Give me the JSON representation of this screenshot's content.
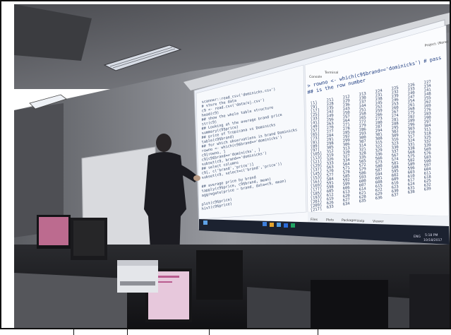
{
  "photo": {
    "description_free": true,
    "console": {
      "command": "> rowno <- which(c9$brand=='dominicks') # pass",
      "subtitle": "## is the row number",
      "tabs": [
        "Console",
        "Terminal"
      ],
      "rows": [
        [
          "[1]",
          "211",
          "212",
          "213",
          "224",
          "225",
          "226",
          "227"
        ],
        [
          "[9]",
          "228",
          "229",
          "230",
          "231",
          "232",
          "233",
          "234"
        ],
        [
          "[17]",
          "235",
          "236",
          "237",
          "238",
          "239",
          "240",
          "241"
        ],
        [
          "[25]",
          "242",
          "243",
          "244",
          "245",
          "246",
          "247",
          "248"
        ],
        [
          "[33]",
          "249",
          "250",
          "251",
          "252",
          "253",
          "254",
          "255"
        ],
        [
          "[41]",
          "256",
          "257",
          "258",
          "259",
          "260",
          "261",
          "262"
        ],
        [
          "[49]",
          "263",
          "264",
          "265",
          "266",
          "267",
          "268",
          "269"
        ],
        [
          "[57]",
          "270",
          "271",
          "272",
          "273",
          "274",
          "275",
          "276"
        ],
        [
          "[65]",
          "277",
          "278",
          "279",
          "280",
          "281",
          "282",
          "283"
        ],
        [
          "[73]",
          "284",
          "285",
          "286",
          "287",
          "288",
          "289",
          "290"
        ],
        [
          "[81]",
          "291",
          "292",
          "293",
          "294",
          "295",
          "296",
          "297"
        ],
        [
          "[89]",
          "298",
          "299",
          "300",
          "301",
          "302",
          "303",
          "304"
        ],
        [
          "[97]",
          "305",
          "306",
          "307",
          "308",
          "309",
          "310",
          "311"
        ],
        [
          "[105]",
          "312",
          "313",
          "314",
          "315",
          "316",
          "317",
          "318"
        ],
        [
          "[113]",
          "319",
          "320",
          "321",
          "322",
          "323",
          "324",
          "325"
        ],
        [
          "[121]",
          "326",
          "327",
          "328",
          "329",
          "330",
          "331",
          "332"
        ],
        [
          "[129]",
          "333",
          "334",
          "335",
          "336",
          "337",
          "338",
          "339"
        ],
        [
          "[137]",
          "563",
          "564",
          "565",
          "566",
          "567",
          "568",
          "569"
        ],
        [
          "[145]",
          "570",
          "571",
          "572",
          "573",
          "574",
          "575",
          "576"
        ],
        [
          "[153]",
          "577",
          "578",
          "579",
          "580",
          "581",
          "582",
          "583"
        ],
        [
          "[161]",
          "584",
          "585",
          "586",
          "587",
          "588",
          "589",
          "590"
        ],
        [
          "[169]",
          "591",
          "592",
          "593",
          "594",
          "595",
          "596",
          "597"
        ],
        [
          "[177]",
          "598",
          "599",
          "600",
          "601",
          "602",
          "603",
          "604"
        ],
        [
          "[185]",
          "605",
          "606",
          "607",
          "608",
          "609",
          "610",
          "611"
        ],
        [
          "[193]",
          "612",
          "613",
          "614",
          "615",
          "616",
          "617",
          "618"
        ],
        [
          "[201]",
          "619",
          "620",
          "621",
          "622",
          "623",
          "624",
          "625"
        ],
        [
          "[209]",
          "626",
          "627",
          "628",
          "629",
          "630",
          "631",
          "632"
        ],
        [
          "[217]",
          "633",
          "634",
          "635",
          "636",
          "637",
          "638",
          "639"
        ]
      ]
    },
    "editor": {
      "lines": [
        "scanner::read_csv('dominicks.csv')",
        "# store the data",
        "c9 <- read.csv('data/oj.csv')",
        "head(c9)",
        "## show the whole table structure",
        "str(c9)",
        "## Looking at the average brand price",
        "summary(c9$price)",
        "## price of Tropicana vs Dominicks",
        "table(c9$brand)",
        "## for which observations is brand Dominicks",
        "rowno <- which(c9$brand=='dominicks')",
        "c9[rowno, ]",
        "c9[c9$brand=='dominicks', ]",
        "subset(c9, brand=='dominicks')",
        "## select columns",
        "c9[, c('brand','price')]",
        "subset(c9, select=c('brand','price'))",
        "",
        "## average price by brand",
        "tapply(c9$price, c9$brand, mean)",
        "aggregate(price ~ brand, data=c9, mean)",
        "",
        "plot(c9$price)",
        "hist(c9$price)"
      ]
    },
    "panels": {
      "files_tabs": [
        "Files",
        "Plots",
        "Packages",
        "Help",
        "Viewer"
      ],
      "project": "Project: (None)"
    },
    "taskbar": {
      "time": "5:18 PM",
      "date": "10/18/2017",
      "lang": "ENG"
    },
    "colors": {
      "screen": "#f3f6fb",
      "wall": "#8b8d93",
      "ceiling": "#6f7177",
      "person": "#1c1c22",
      "desk": "#55565b"
    }
  }
}
